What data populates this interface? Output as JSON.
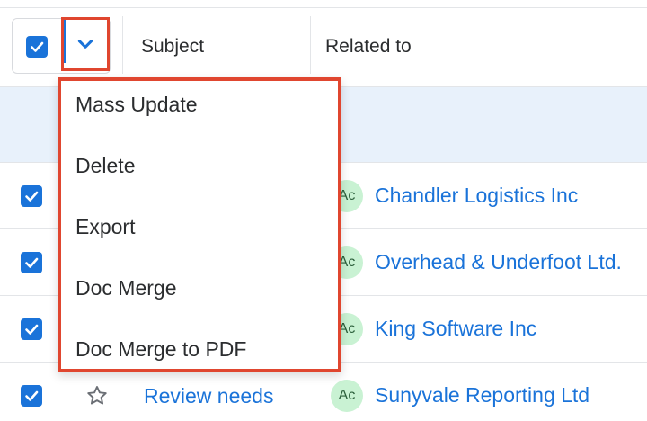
{
  "header": {
    "subject_label": "Subject",
    "related_label": "Related to",
    "master_checked": true
  },
  "mass_actions_menu": {
    "items": [
      {
        "label": "Mass Update"
      },
      {
        "label": "Delete"
      },
      {
        "label": "Export"
      },
      {
        "label": "Doc Merge"
      },
      {
        "label": "Doc Merge to PDF"
      }
    ]
  },
  "rows": [
    {
      "checked": true,
      "avatar": "Ac",
      "related": "Chandler Logistics Inc"
    },
    {
      "checked": true,
      "avatar": "Ac",
      "related": "Overhead & Underfoot Ltd."
    },
    {
      "checked": true,
      "avatar": "Ac",
      "related": "King Software Inc"
    },
    {
      "checked": true,
      "favorite": false,
      "subject": "Review needs",
      "avatar": "Ac",
      "related": "Sunyvale Reporting Ltd"
    }
  ],
  "colors": {
    "accent": "#1a73d9",
    "highlight_border": "#e0462f",
    "selected_band": "#e8f1fb",
    "avatar_bg": "#c9f2d3"
  },
  "icons": {
    "checkbox": "checkmark-icon",
    "dropdown": "chevron-down-icon",
    "favorite": "star-outline-icon"
  }
}
